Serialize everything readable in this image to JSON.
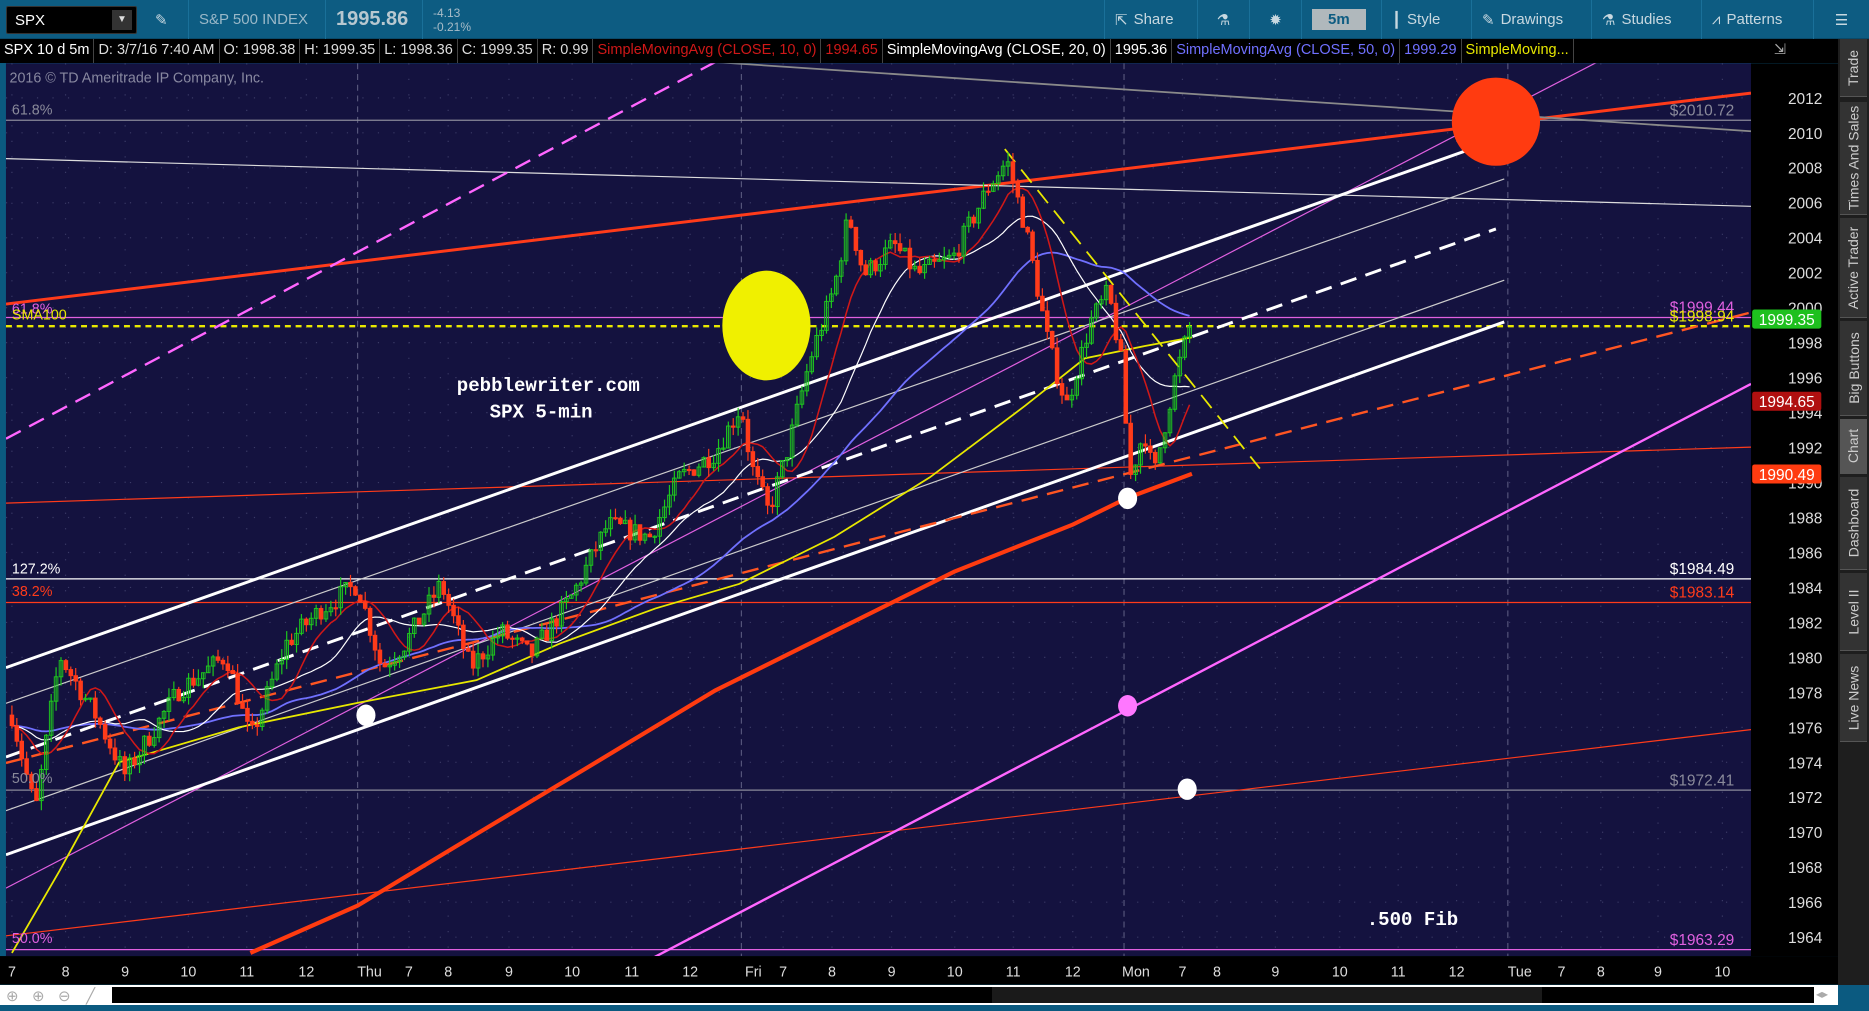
{
  "toolbar": {
    "symbol": "SPX",
    "description": "S&P 500 INDEX",
    "last": "1995.86",
    "change": "-4.13",
    "change_pct": "-0.21%",
    "share": "Share",
    "timeframe": "5m",
    "style": "Style",
    "drawings": "Drawings",
    "studies": "Studies",
    "patterns": "Patterns"
  },
  "infobar": {
    "label": "SPX 10 d 5m",
    "date": "D: 3/7/16 7:40 AM",
    "open": "O: 1998.38",
    "high": "H: 1999.35",
    "low": "L: 1998.36",
    "close": "C: 1999.35",
    "range": "R: 0.99",
    "sma10_label": "SimpleMovingAvg (CLOSE, 10, 0)",
    "sma10_value": "1994.65",
    "sma20_label": "SimpleMovingAvg (CLOSE, 20, 0)",
    "sma20_value": "1995.36",
    "sma50_label": "SimpleMovingAvg (CLOSE, 50, 0)",
    "sma50_value": "1999.29",
    "sma100_label": "SimpleMoving..."
  },
  "copyright": "2016 © TD Ameritrade IP Company, Inc.",
  "annotations": {
    "site": "pebblewriter.com",
    "subtitle": "SPX 5-min",
    "fib": ".500 Fib"
  },
  "levels": [
    {
      "price": 2010.72,
      "left": "61.8%",
      "right": "$2010.72",
      "color": "#8a8a9a"
    },
    {
      "price": 1999.44,
      "left": "61.8%",
      "right": "$1999.44",
      "color": "#e060e0"
    },
    {
      "price": 1998.94,
      "left": "SMA100",
      "right": "$1998.94",
      "color": "#e8e800",
      "dashed": true
    },
    {
      "price": 1984.49,
      "left": "127.2%",
      "right": "$1984.49",
      "color": "#ffffff"
    },
    {
      "price": 1983.14,
      "left": "38.2%",
      "right": "$1983.14",
      "color": "#ff3b1a"
    },
    {
      "price": 1972.41,
      "left": "50.0%",
      "right": "$1972.41",
      "color": "#8a8a9a"
    },
    {
      "price": 1963.29,
      "left": "50.0%",
      "right": "$1963.29",
      "color": "#e060e0"
    }
  ],
  "price_tags": [
    {
      "value": "1999.35",
      "price": 1999.35,
      "color": "#1ec01e"
    },
    {
      "value": "1994.65",
      "price": 1994.65,
      "color": "#b01010"
    },
    {
      "value": "1990.49",
      "price": 1990.49,
      "color": "#ff3b10"
    }
  ],
  "sidebar_tabs": [
    "Trade",
    "Times And Sales",
    "Active Trader",
    "Big Buttons",
    "Chart",
    "Dashboard",
    "Level II",
    "Live News"
  ],
  "chart_data": {
    "type": "candlestick",
    "symbol": "SPX",
    "interval": "5m",
    "ylim": [
      1962.5,
      2013.5
    ],
    "y_ticks": [
      1964,
      1966,
      1968,
      1970,
      1972,
      1974,
      1976,
      1978,
      1980,
      1982,
      1984,
      1986,
      1988,
      1990,
      1992,
      1994,
      1996,
      1998,
      2000,
      2002,
      2004,
      2006,
      2008,
      2010,
      2012
    ],
    "x_ticks": [
      "7",
      "8",
      "9",
      "10",
      "11",
      "12",
      "Thu",
      "7",
      "8",
      "9",
      "10",
      "11",
      "12",
      "Fri",
      "7",
      "8",
      "9",
      "10",
      "11",
      "12",
      "Mon",
      "7",
      "8",
      "9",
      "10",
      "11",
      "12",
      "Tue",
      "7",
      "8",
      "9",
      "10"
    ],
    "price_path": [
      [
        0,
        1976.7
      ],
      [
        0.4,
        1971.2
      ],
      [
        0.81,
        1980.1
      ],
      [
        1.42,
        1976.7
      ],
      [
        1.92,
        1973.3
      ],
      [
        2.83,
        1978.1
      ],
      [
        3.64,
        1980.1
      ],
      [
        4.05,
        1975.3
      ],
      [
        4.66,
        1980.8
      ],
      [
        5.26,
        1982.8
      ],
      [
        5.87,
        1984.2
      ],
      [
        6.28,
        1979.4
      ],
      [
        6.68,
        1980.8
      ],
      [
        7.29,
        1984.2
      ],
      [
        7.79,
        1979.4
      ],
      [
        8.3,
        1981.5
      ],
      [
        8.81,
        1980.1
      ],
      [
        9.51,
        1983.5
      ],
      [
        10.12,
        1987.6
      ],
      [
        10.83,
        1986.9
      ],
      [
        11.34,
        1990.3
      ],
      [
        11.94,
        1991.7
      ],
      [
        12.39,
        1994.4
      ],
      [
        12.55,
        1991.0
      ],
      [
        12.85,
        1988.3
      ],
      [
        13.16,
        1991.7
      ],
      [
        13.56,
        1997.1
      ],
      [
        13.97,
        2001.2
      ],
      [
        14.21,
        2005.3
      ],
      [
        14.47,
        2001.9
      ],
      [
        14.98,
        2003.6
      ],
      [
        15.38,
        2001.9
      ],
      [
        15.99,
        2002.9
      ],
      [
        16.6,
        2007.0
      ],
      [
        16.9,
        2008.4
      ],
      [
        17.21,
        2004.6
      ],
      [
        17.61,
        1997.8
      ],
      [
        17.91,
        1994.4
      ],
      [
        18.32,
        1999.2
      ],
      [
        18.62,
        2000.9
      ],
      [
        18.83,
        1997.1
      ],
      [
        18.99,
        1990.3
      ],
      [
        19.23,
        1993.0
      ],
      [
        19.39,
        1990.3
      ],
      [
        19.74,
        1995.8
      ],
      [
        20.04,
        1999.35
      ]
    ],
    "sma100": [
      [
        0,
        1963.1
      ],
      [
        0.81,
        1967.8
      ],
      [
        1.82,
        1974.0
      ],
      [
        3.85,
        1976.0
      ],
      [
        5.87,
        1977.4
      ],
      [
        7.89,
        1978.7
      ],
      [
        9.31,
        1980.8
      ],
      [
        10.93,
        1982.8
      ],
      [
        12.35,
        1984.2
      ],
      [
        13.97,
        1986.9
      ],
      [
        15.59,
        1990.3
      ],
      [
        17.21,
        1994.4
      ],
      [
        18.22,
        1997.1
      ],
      [
        19.23,
        1997.8
      ],
      [
        20.04,
        1998.3
      ]
    ],
    "sma200": [
      [
        4.05,
        1963.1
      ],
      [
        5.87,
        1965.8
      ],
      [
        7.89,
        1969.9
      ],
      [
        9.92,
        1974.0
      ],
      [
        11.94,
        1978.1
      ],
      [
        13.97,
        1981.5
      ],
      [
        16.0,
        1984.9
      ],
      [
        18.02,
        1987.6
      ],
      [
        18.93,
        1989.1
      ],
      [
        20.04,
        1990.5
      ]
    ],
    "series_colors": {
      "sma10": "#d01818",
      "sma20": "#ffffff",
      "sma50": "#7070ff",
      "sma100": "#e8e800",
      "sma200": "#ff3b10",
      "up": "#1ec81e",
      "down": "#ff3b1a"
    }
  }
}
